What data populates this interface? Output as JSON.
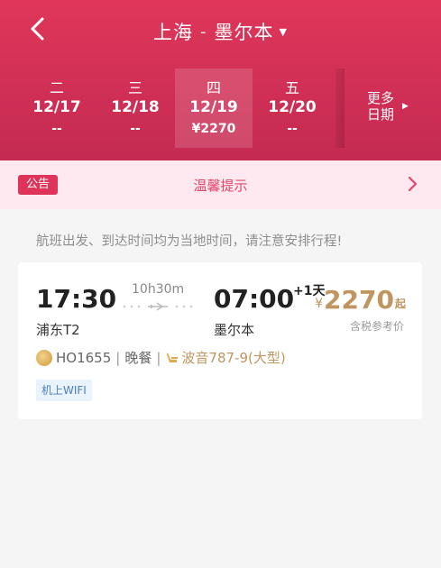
{
  "header": {
    "origin": "上海",
    "separator": "-",
    "destination": "墨尔本",
    "colors": {
      "start": "#e0365a",
      "end": "#c42a52"
    }
  },
  "dates": [
    {
      "weekday": "二",
      "date": "12/17",
      "price": "--",
      "active": false
    },
    {
      "weekday": "三",
      "date": "12/18",
      "price": "--",
      "active": false
    },
    {
      "weekday": "四",
      "date": "12/19",
      "price": "¥2270",
      "active": true
    },
    {
      "weekday": "五",
      "date": "12/20",
      "price": "--",
      "active": false
    }
  ],
  "more_dates": {
    "line1": "更多",
    "line2": "日期"
  },
  "notice": {
    "badge": "公告",
    "title": "温馨提示"
  },
  "tip": "航班出发、到达时间均为当地时间，请注意安排行程!",
  "flight": {
    "dep_time": "17:30",
    "dep_airport": "浦东T2",
    "duration": "10h30m",
    "arr_time": "07:00",
    "day_offset": "+1天",
    "arr_airport": "墨尔本",
    "price_currency": "¥",
    "price_amount": "2270",
    "price_suffix": "起",
    "tax_note": "含税参考价",
    "flight_no": "HO1655",
    "meal": "晚餐",
    "aircraft": "波音787-9(大型)",
    "tag": "机上WIFI",
    "price_color": "#c09560"
  }
}
